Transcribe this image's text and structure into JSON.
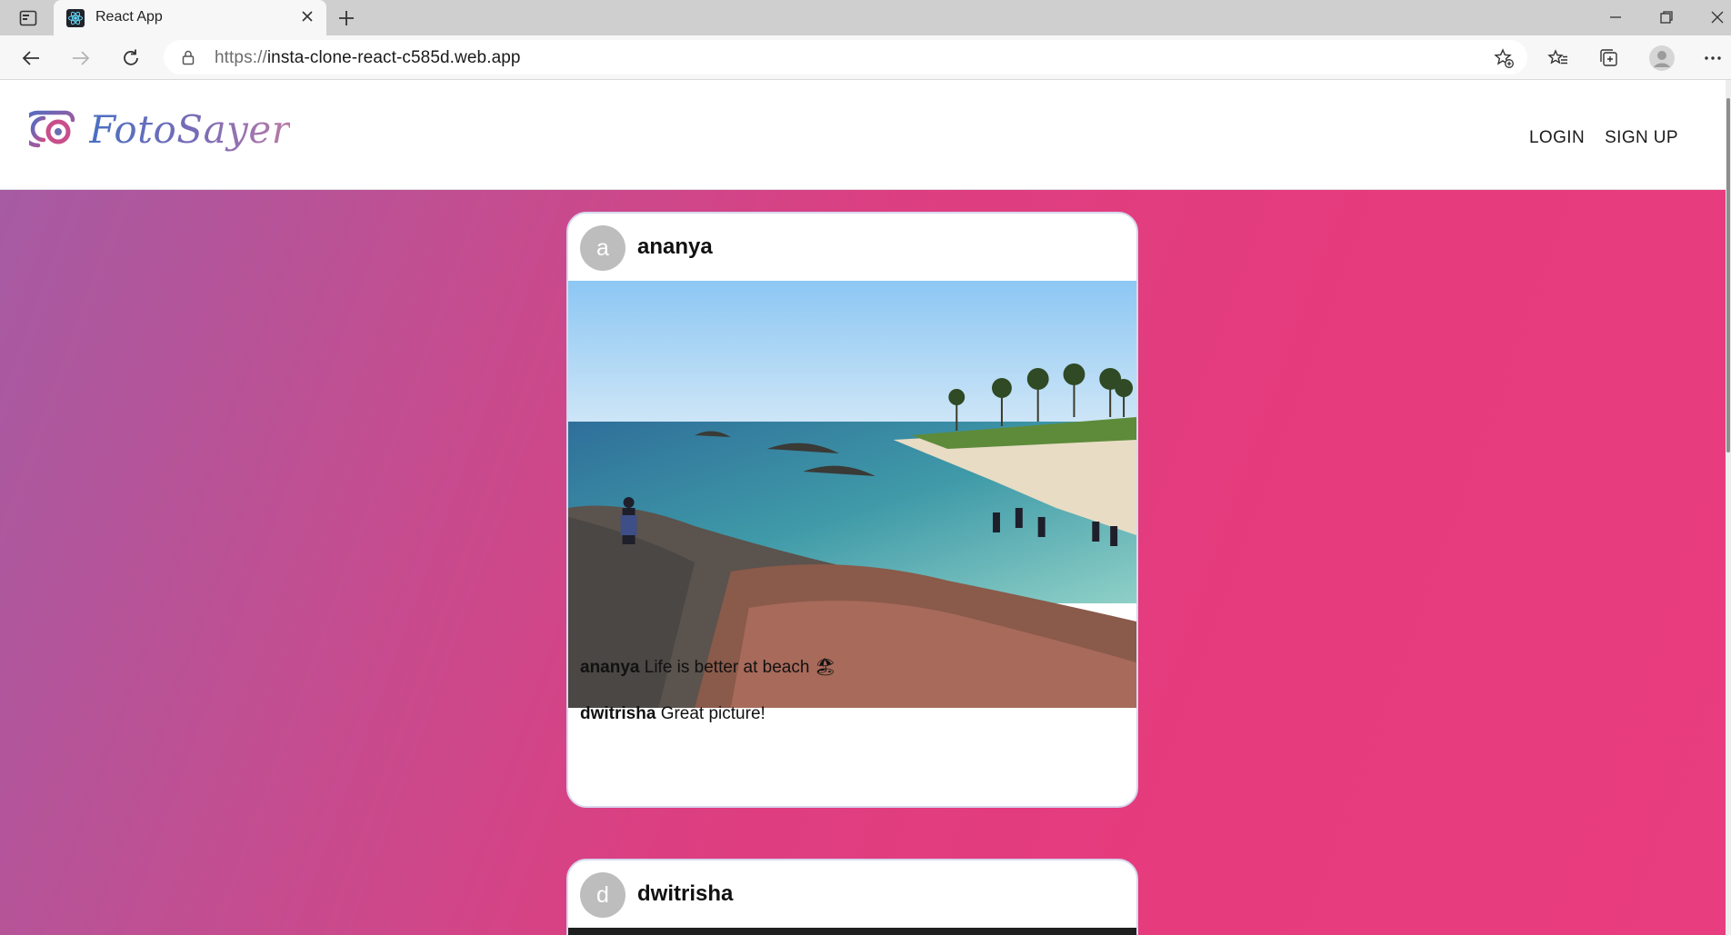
{
  "browser": {
    "tab_title": "React App",
    "url_protocol": "https://",
    "url_host": "insta-clone-react-c585d.web.app"
  },
  "app": {
    "brand": "FotoSayer",
    "nav": {
      "login": "LOGIN",
      "signup": "SIGN UP"
    }
  },
  "posts": [
    {
      "avatar_letter": "a",
      "username": "ananya",
      "caption_user": "ananya",
      "caption_text": "Life is better at beach 🏖",
      "comments": [
        {
          "user": "dwitrisha",
          "text": "Great picture!"
        }
      ]
    },
    {
      "avatar_letter": "d",
      "username": "dwitrisha"
    }
  ],
  "colors": {
    "gradient_start": "#a65ba3",
    "gradient_end": "#e83d7e",
    "brand": "#5a6fb8"
  }
}
